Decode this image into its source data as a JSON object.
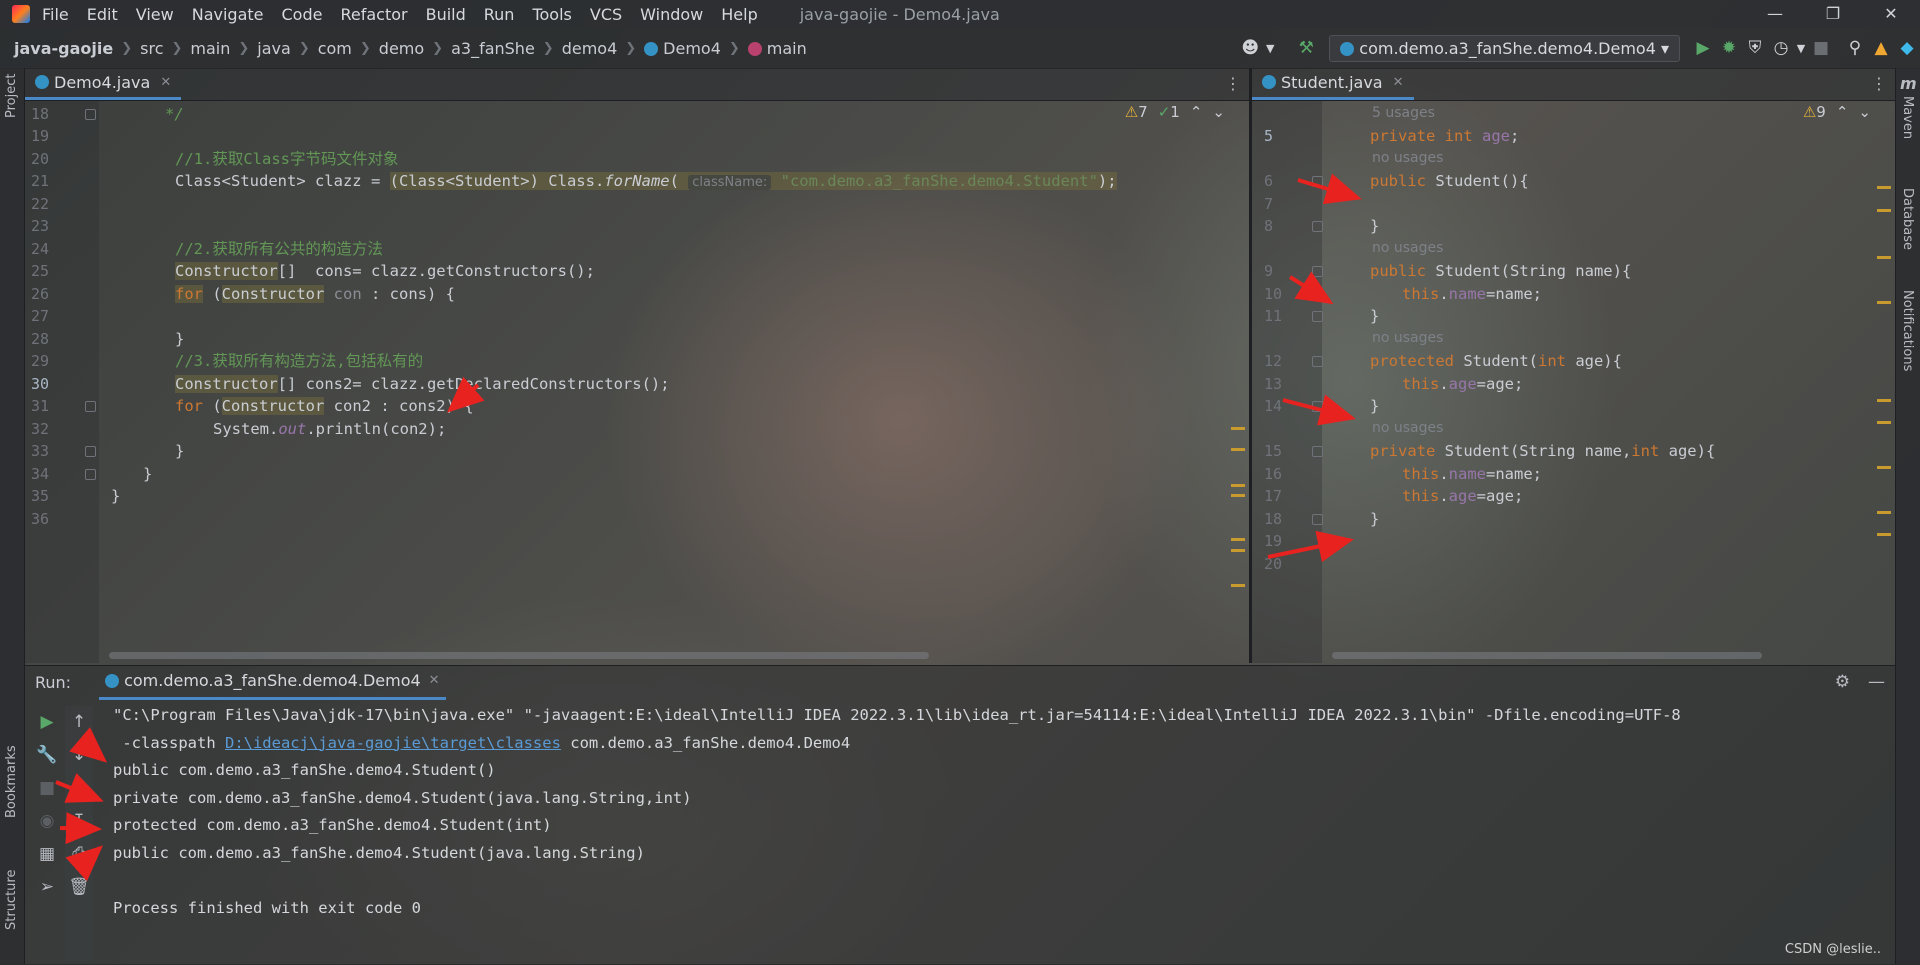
{
  "menubar": {
    "items": [
      "File",
      "Edit",
      "View",
      "Navigate",
      "Code",
      "Refactor",
      "Build",
      "Run",
      "Tools",
      "VCS",
      "Window",
      "Help"
    ],
    "title": "java-gaojie - Demo4.java"
  },
  "breadcrumb": {
    "items": [
      "java-gaojie",
      "src",
      "main",
      "java",
      "com",
      "demo",
      "a3_fanShe",
      "demo4",
      "Demo4",
      "main"
    ]
  },
  "toolbar": {
    "run_config": "com.demo.a3_fanShe.demo4.Demo4"
  },
  "left_stripe": {
    "project": "Project",
    "bookmarks": "Bookmarks",
    "structure": "Structure"
  },
  "right_stripe": {
    "maven": "Maven",
    "database": "Database",
    "notifications": "Notifications"
  },
  "editor_left": {
    "tab": "Demo4.java",
    "warnings": "7",
    "weak_warnings": "1",
    "lines": [
      "18",
      "19",
      "20",
      "21",
      "22",
      "23",
      "24",
      "25",
      "26",
      "27",
      "28",
      "29",
      "30",
      "31",
      "32",
      "33",
      "34",
      "35",
      "36"
    ],
    "code": {
      "c18": "*/",
      "c20": "//1.获取Class字节码文件对象",
      "c21_a": "Class<Student> clazz = ",
      "c21_b": "(Class<Student>) Class.",
      "c21_c": "forName",
      "c21_d": "( ",
      "c21_hint": "className:",
      "c21_str": "\"com.demo.a3_fanShe.demo4.Student\"",
      "c21_e": ");",
      "c24": "//2.获取所有公共的构造方法",
      "c25_a": "Constructor",
      "c25_b": "[]  cons= clazz.getConstructors();",
      "c26_kw": "for",
      "c26_a": " (",
      "c26_b": "Constructor",
      "c26_c": " con",
      "c26_d": " : cons) {",
      "c28": "}",
      "c29": "//3.获取所有构造方法,包括私有的",
      "c30_a": "Constructor",
      "c30_b": "[] cons2= clazz.getDeclaredConstructors();",
      "c31_kw": "for",
      "c31_a": " (",
      "c31_b": "Constructor",
      "c31_c": " con2 : cons2) {",
      "c32_a": "System.",
      "c32_b": "out",
      "c32_c": ".println(con2);",
      "c33": "}",
      "c34": "}",
      "c35": "}"
    }
  },
  "editor_right": {
    "tab": "Student.java",
    "warnings": "9",
    "usages": {
      "u5": "5 usages",
      "u6": "no usages",
      "u9": "no usages",
      "u12": "no usages",
      "u15": "no usages"
    },
    "lines": [
      "5",
      "6",
      "7",
      "8",
      "9",
      "10",
      "11",
      "12",
      "13",
      "14",
      "15",
      "16",
      "17",
      "18",
      "19",
      "20"
    ],
    "code": {
      "r5_a": "private int ",
      "r5_b": "age",
      "r5_c": ";",
      "r6_a": "public ",
      "r6_b": "Student(){",
      "r8": "}",
      "r9_a": "public ",
      "r9_b": "Student(String name){",
      "r10_a": "this",
      "r10_b": ".",
      "r10_c": "name",
      "r10_d": "=name;",
      "r11": "}",
      "r12_a": "protected ",
      "r12_b": "Student(",
      "r12_c": "int ",
      "r12_d": "age){",
      "r13_a": "this",
      "r13_b": ".",
      "r13_c": "age",
      "r13_d": "=age;",
      "r14": "}",
      "r15_a": "private ",
      "r15_b": "Student(String name,",
      "r15_c": "int ",
      "r15_d": "age){",
      "r16_a": "this",
      "r16_b": ".",
      "r16_c": "name",
      "r16_d": "=name;",
      "r17_a": "this",
      "r17_b": ".",
      "r17_c": "age",
      "r17_d": "=age;",
      "r18": "}"
    }
  },
  "run": {
    "label": "Run:",
    "tab": "com.demo.a3_fanShe.demo4.Demo4",
    "console": {
      "l1": "\"C:\\Program Files\\Java\\jdk-17\\bin\\java.exe\" \"-javaagent:E:\\ideal\\IntelliJ IDEA 2022.3.1\\lib\\idea_rt.jar=54114:E:\\ideal\\IntelliJ IDEA 2022.3.1\\bin\" -Dfile.encoding=UTF-8",
      "l2_a": " -classpath ",
      "l2_link": "D:\\ideacj\\java-gaojie\\target\\classes",
      "l2_b": " com.demo.a3_fanShe.demo4.Demo4",
      "l3": "public com.demo.a3_fanShe.demo4.Student()",
      "l4": "private com.demo.a3_fanShe.demo4.Student(java.lang.String,int)",
      "l5": "protected com.demo.a3_fanShe.demo4.Student(int)",
      "l6": "public com.demo.a3_fanShe.demo4.Student(java.lang.String)",
      "l7": "",
      "l8": "Process finished with exit code 0"
    }
  },
  "watermark": "CSDN @leslie..",
  "colors": {
    "keyword": "#cc7832",
    "comment": "#629755",
    "string": "#6a8759",
    "field": "#9876aa",
    "accent": "#4a88c7",
    "arrow": "#e8231f"
  },
  "icons": [
    "app-logo-icon",
    "hammer-icon",
    "run-icon",
    "debug-icon",
    "coverage-icon",
    "profile-icon",
    "stop-icon",
    "search-icon",
    "update-icon",
    "ide-toolbox-icon",
    "gear-icon",
    "minimize-icon",
    "rerun-icon",
    "wrench-icon",
    "up-arrow-icon",
    "down-arrow-icon",
    "soft-wrap-icon",
    "scroll-end-icon",
    "print-icon",
    "trash-icon",
    "layout-icon",
    "pin-icon"
  ]
}
